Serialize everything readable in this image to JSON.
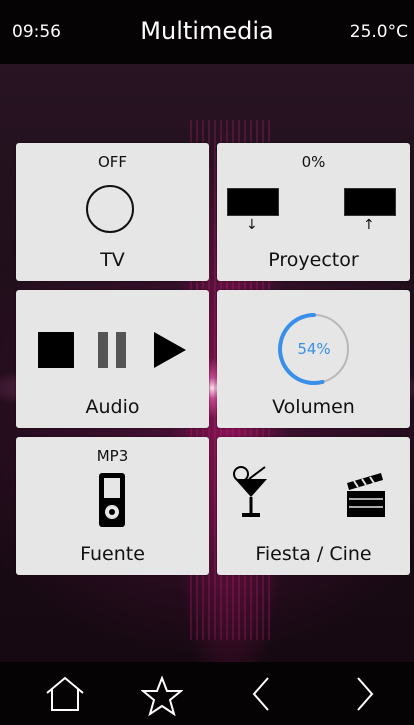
{
  "header": {
    "time": "09:56",
    "title": "Multimedia",
    "temperature": "25.0°C"
  },
  "tiles": [
    {
      "status": "OFF",
      "label": "TV",
      "icon": "power-circle-icon"
    },
    {
      "status": "0%",
      "label": "Proyector",
      "icon": "projector-screen-icon"
    },
    {
      "status": "",
      "label": "Audio",
      "icon": "playback-controls-icon"
    },
    {
      "status": "54%",
      "label": "Volumen",
      "icon": "volume-gauge-icon",
      "level": 0.54
    },
    {
      "status": "MP3",
      "label": "Fuente",
      "icon": "music-player-icon"
    },
    {
      "status": "",
      "label": "Fiesta / Cine",
      "icon": "cocktail-clapperboard-icon"
    }
  ],
  "nav": {
    "items": [
      "home-icon",
      "star-icon",
      "back-chevron-icon",
      "forward-chevron-icon"
    ]
  },
  "colors": {
    "accent_blue": "#3a8fe8",
    "tile_bg": "#e6e6e6",
    "bar_bg": "#050304"
  }
}
